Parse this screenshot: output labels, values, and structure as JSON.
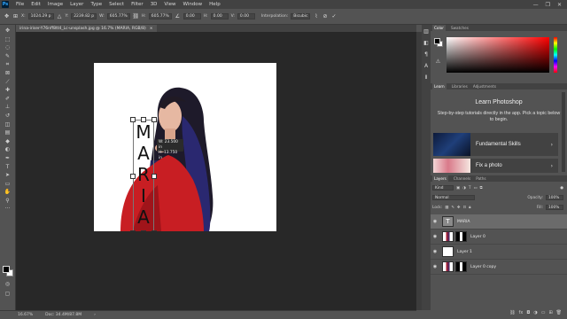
{
  "menubar": {
    "app_logo": "Ps",
    "items": [
      "File",
      "Edit",
      "Image",
      "Layer",
      "Type",
      "Select",
      "Filter",
      "3D",
      "View",
      "Window",
      "Help"
    ],
    "window_controls": [
      "—",
      "❐",
      "✕"
    ]
  },
  "options_bar": {
    "x_label": "X:",
    "x_value": "1024.29 p",
    "y_label": "Y:",
    "y_value": "2239.82 p",
    "w_label": "W:",
    "w_value": "605.77%",
    "h_label": "H:",
    "h_value": "605.77%",
    "angle_value": "0.00",
    "h_skew_label": "H:",
    "h_skew_value": "0.00",
    "v_skew_label": "V:",
    "v_skew_value": "0.00",
    "interpolation_label": "Interpolation:",
    "interpolation_value": "Bicubic",
    "cancel_icon": "cancel-transform-icon",
    "commit_icon": "commit-transform-icon"
  },
  "document": {
    "tab_title": "irina-iriser-Y76nff8tt4_Lc-unsplash.jpg @ 16.7% (MARIA, RGB/8)",
    "tab_close": "×",
    "transform_readout": [
      "W: 23.500 in",
      "H: 13.750 in"
    ]
  },
  "canvas_text": {
    "letters": [
      "M",
      "A",
      "R",
      "I",
      "A"
    ]
  },
  "status_bar": {
    "zoom": "16.67%",
    "doc_size": "Doc: 34.4M/87.8M"
  },
  "color_panel": {
    "tabs": [
      "Color",
      "Swatches"
    ],
    "active_tab": "Color",
    "foreground": "#000000",
    "background": "#ffffff"
  },
  "learn_panel": {
    "tabs": [
      "Learn",
      "Libraries",
      "Adjustments"
    ],
    "active_tab": "Learn",
    "title": "Learn Photoshop",
    "description": "Step-by-step tutorials directly in the app. Pick a topic below to begin.",
    "cards": [
      {
        "label": "Fundamental Skills",
        "chevron": "›"
      },
      {
        "label": "Fix a photo",
        "chevron": "›"
      }
    ]
  },
  "layers_panel": {
    "tabs": [
      "Layers",
      "Channels",
      "Paths"
    ],
    "active_tab": "Layers",
    "filter_label": "Kind",
    "blend_mode": "Normal",
    "opacity_label": "Opacity:",
    "opacity_value": "100%",
    "lock_label": "Lock:",
    "fill_label": "Fill:",
    "fill_value": "100%",
    "layers": [
      {
        "name": "MARIA",
        "type": "text",
        "selected": true
      },
      {
        "name": "Layer 0",
        "type": "image",
        "selected": false
      },
      {
        "name": "Layer 1",
        "type": "fill",
        "selected": false
      },
      {
        "name": "Layer 0 copy",
        "type": "image",
        "selected": false
      }
    ],
    "footer_icons": [
      "link-icon",
      "fx-icon",
      "mask-icon",
      "adjustment-icon",
      "folder-icon",
      "new-layer-icon",
      "trash-icon"
    ]
  },
  "colors": {
    "ui_dark": "#535353",
    "workspace": "#282828",
    "accent_blue": "#31a8ff",
    "selection_row": "#6b6b6b"
  }
}
